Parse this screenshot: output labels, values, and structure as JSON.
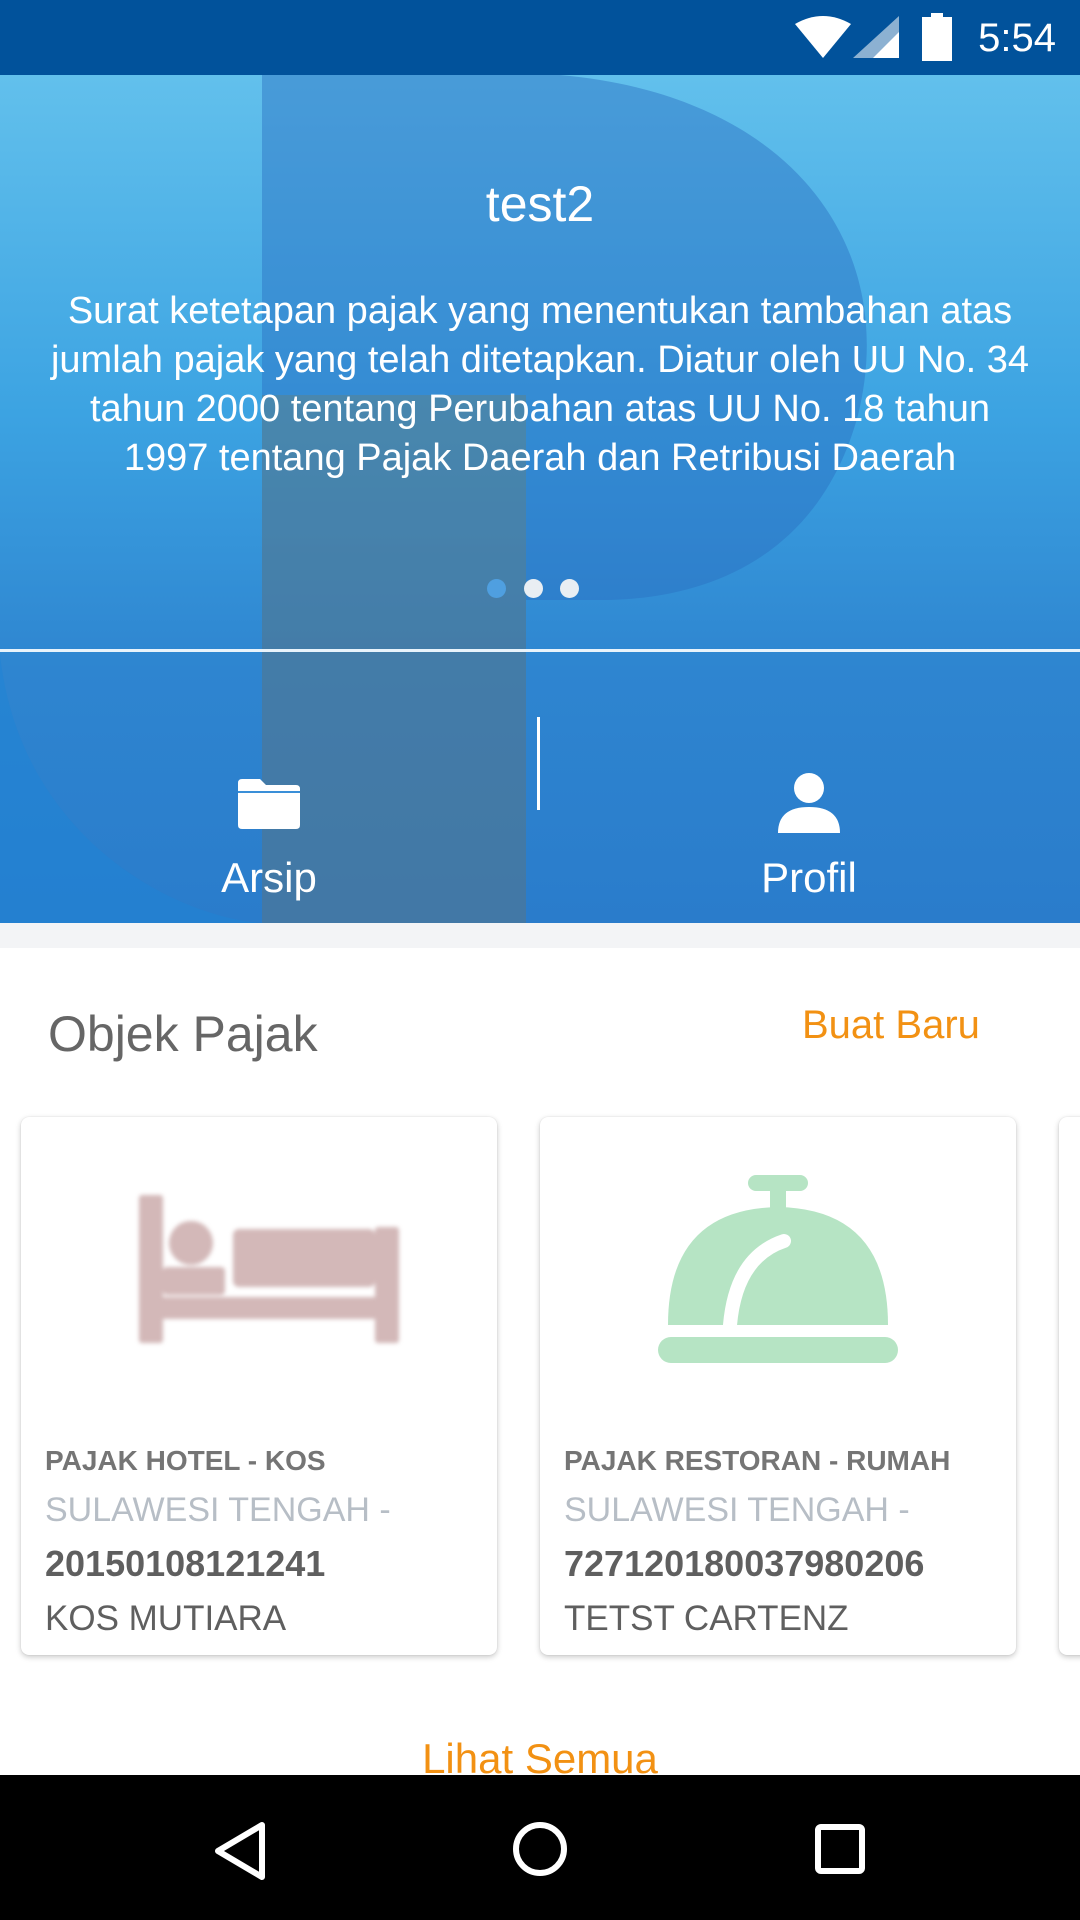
{
  "status_bar": {
    "time": "5:54",
    "icons": [
      "wifi-icon",
      "signal-icon",
      "battery-icon"
    ]
  },
  "carousel": {
    "title": "test2",
    "description": "Surat ketetapan pajak yang menentukan tambahan atas jumlah pajak yang telah ditetapkan. Diatur oleh UU No. 34 tahun 2000 tentang Perubahan atas UU No. 18 tahun 1997 tentang Pajak Daerah dan Retribusi Daerah",
    "page_count": 3,
    "active_page": 1
  },
  "menu": {
    "items": [
      {
        "label": "Arsip",
        "icon": "folder-icon"
      },
      {
        "label": "Profil",
        "icon": "person-icon"
      }
    ]
  },
  "section": {
    "title": "Objek Pajak",
    "create_label": "Buat Baru",
    "view_all_label": "Lihat Semua"
  },
  "cards": [
    {
      "icon": "bed-icon",
      "category": "PAJAK HOTEL - KOS",
      "region": "SULAWESI TENGAH -",
      "number": "20150108121241",
      "name": "KOS MUTIARA"
    },
    {
      "icon": "service-bell-icon",
      "category": "PAJAK RESTORAN - RUMAH",
      "region": "SULAWESI TENGAH -",
      "number": "72712018003798020​6",
      "name": "TETST CARTENZ"
    }
  ],
  "colors": {
    "status_bar": "#01529b",
    "accent": "#f29113",
    "hotel_icon": "#d3b8b8",
    "restaurant_icon": "#b6e4c4"
  },
  "nav_bar": {
    "buttons": [
      "back-icon",
      "home-icon",
      "recents-icon"
    ]
  }
}
